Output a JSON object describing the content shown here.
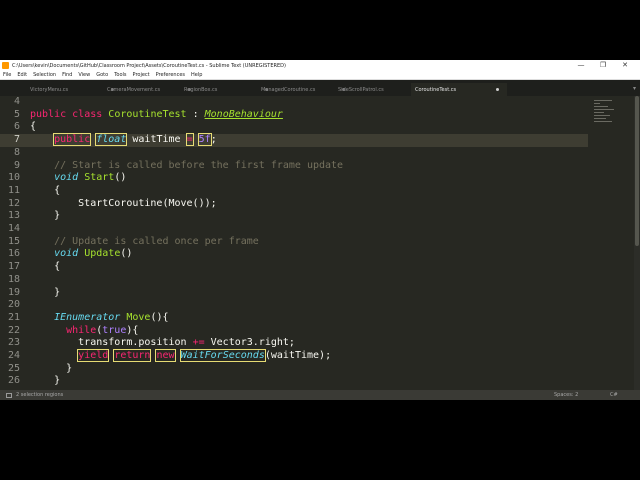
{
  "window": {
    "title": "C:\\Users\\kevin\\Documents\\GitHub\\Classroom Project\\Assets\\CoroutineTest.cs - Sublime Text (UNREGISTERED)",
    "controls": [
      "—",
      "❐",
      "✕"
    ]
  },
  "menu": [
    "File",
    "Edit",
    "Selection",
    "Find",
    "View",
    "Goto",
    "Tools",
    "Project",
    "Preferences",
    "Help"
  ],
  "tabs": [
    {
      "label": "VictoryMenu.cs",
      "active": false
    },
    {
      "label": "CameraMovement.cs",
      "active": false
    },
    {
      "label": "RegionBox.cs",
      "active": false
    },
    {
      "label": "ManagedCoroutine.cs",
      "active": false
    },
    {
      "label": "SideScrollPatrol.cs",
      "active": false
    },
    {
      "label": "CoroutineTest.cs",
      "active": true
    }
  ],
  "editor": {
    "current_line": 7,
    "lines": [
      {
        "n": "4",
        "tokens": []
      },
      {
        "n": "5",
        "tokens": [
          {
            "t": "public",
            "c": "kw"
          },
          {
            "t": " "
          },
          {
            "t": "class",
            "c": "kw"
          },
          {
            "t": " "
          },
          {
            "t": "CoroutineTest",
            "c": "cls"
          },
          {
            "t": " : "
          },
          {
            "t": "MonoBehaviour",
            "c": "inh"
          }
        ]
      },
      {
        "n": "6",
        "tokens": [
          {
            "t": "{"
          }
        ]
      },
      {
        "n": "7",
        "tokens": [
          {
            "t": "    "
          },
          {
            "t": "public",
            "c": "kw sel"
          },
          {
            "t": " "
          },
          {
            "t": "float",
            "c": "type sel"
          },
          {
            "t": " waitTime "
          },
          {
            "t": "=",
            "c": "kw sel"
          },
          {
            "t": " "
          },
          {
            "t": "5f",
            "c": "num sel"
          },
          {
            "t": ";"
          }
        ]
      },
      {
        "n": "8",
        "tokens": []
      },
      {
        "n": "9",
        "tokens": [
          {
            "t": "    "
          },
          {
            "t": "// Start is called before the first frame update",
            "c": "com"
          }
        ]
      },
      {
        "n": "10",
        "tokens": [
          {
            "t": "    "
          },
          {
            "t": "void",
            "c": "type"
          },
          {
            "t": " "
          },
          {
            "t": "Start",
            "c": "fn"
          },
          {
            "t": "()"
          }
        ]
      },
      {
        "n": "11",
        "tokens": [
          {
            "t": "    {"
          }
        ]
      },
      {
        "n": "12",
        "tokens": [
          {
            "t": "        StartCoroutine(Move());"
          }
        ]
      },
      {
        "n": "13",
        "tokens": [
          {
            "t": "    }"
          }
        ]
      },
      {
        "n": "14",
        "tokens": []
      },
      {
        "n": "15",
        "tokens": [
          {
            "t": "    "
          },
          {
            "t": "// Update is called once per frame",
            "c": "com"
          }
        ]
      },
      {
        "n": "16",
        "tokens": [
          {
            "t": "    "
          },
          {
            "t": "void",
            "c": "type"
          },
          {
            "t": " "
          },
          {
            "t": "Update",
            "c": "fn"
          },
          {
            "t": "()"
          }
        ]
      },
      {
        "n": "17",
        "tokens": [
          {
            "t": "    {"
          }
        ]
      },
      {
        "n": "18",
        "tokens": []
      },
      {
        "n": "19",
        "tokens": [
          {
            "t": "    }"
          }
        ]
      },
      {
        "n": "20",
        "tokens": []
      },
      {
        "n": "21",
        "tokens": [
          {
            "t": "    "
          },
          {
            "t": "IEnumerator",
            "c": "type"
          },
          {
            "t": " "
          },
          {
            "t": "Move",
            "c": "fn"
          },
          {
            "t": "(){"
          }
        ]
      },
      {
        "n": "22",
        "tokens": [
          {
            "t": "      "
          },
          {
            "t": "while",
            "c": "kw"
          },
          {
            "t": "("
          },
          {
            "t": "true",
            "c": "num"
          },
          {
            "t": "){"
          }
        ]
      },
      {
        "n": "23",
        "tokens": [
          {
            "t": "        transform.position "
          },
          {
            "t": "+=",
            "c": "kw"
          },
          {
            "t": " Vector3.right;"
          }
        ]
      },
      {
        "n": "24",
        "tokens": [
          {
            "t": "        "
          },
          {
            "t": "yield",
            "c": "kw sel"
          },
          {
            "t": " "
          },
          {
            "t": "return",
            "c": "kw sel"
          },
          {
            "t": " "
          },
          {
            "t": "new",
            "c": "kw sel"
          },
          {
            "t": " "
          },
          {
            "t": "WaitForSeconds",
            "c": "type sel"
          },
          {
            "t": "(waitTime);"
          }
        ]
      },
      {
        "n": "25",
        "tokens": [
          {
            "t": "      }"
          }
        ]
      },
      {
        "n": "26",
        "tokens": [
          {
            "t": "    }"
          }
        ]
      }
    ]
  },
  "status": {
    "left": "2 selection regions",
    "spaces": "Spaces: 2",
    "syntax": "C#"
  }
}
